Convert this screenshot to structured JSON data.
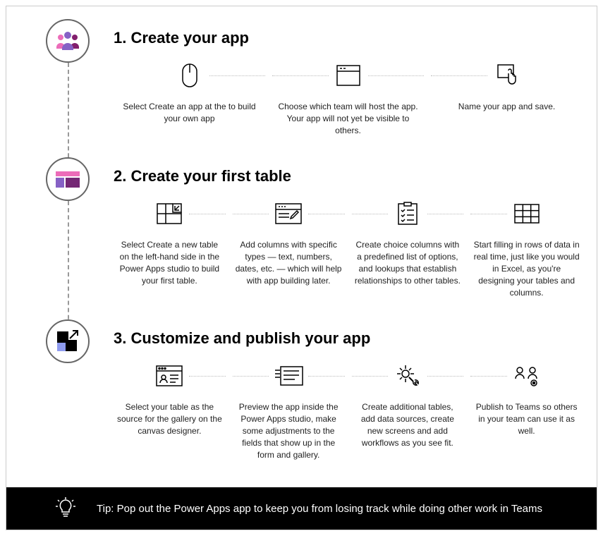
{
  "steps": [
    {
      "title": "1. Create your app",
      "sub": [
        "Select Create an app at the to build your own app",
        "Choose which team will host the app. Your app will not yet be visible to others.",
        "Name your app and save."
      ]
    },
    {
      "title": "2. Create your first table",
      "sub": [
        "Select Create a new table on the left-hand side in the Power Apps studio to build your first table.",
        "Add columns with specific types — text, numbers, dates, etc. — which will help with app building later.",
        "Create choice columns with a predefined list of options, and lookups that establish relationships to other tables.",
        "Start filling in rows of data in real time, just like you would in Excel, as you're designing your tables and columns."
      ]
    },
    {
      "title": "3. Customize and publish your app",
      "sub": [
        "Select your table as the source for the gallery on the canvas designer.",
        "Preview the app inside the Power Apps studio, make some adjustments to the fields that show up in the form and gallery.",
        "Create additional tables, add data sources, create new screens and add workflows as you see fit.",
        "Publish to Teams so others in your team can use it as well."
      ]
    }
  ],
  "tip": "Tip: Pop out the Power Apps app to keep you from losing track while doing other work in Teams"
}
